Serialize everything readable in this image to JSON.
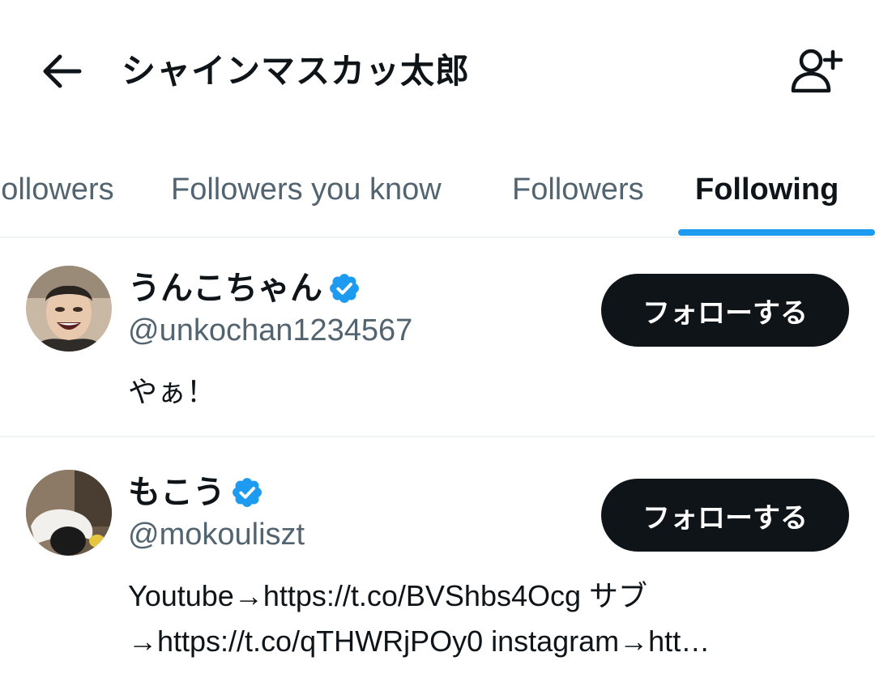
{
  "header": {
    "title": "シャインマスカッ太郎",
    "back_icon": "arrow-left-icon",
    "add_icon": "add-person-icon"
  },
  "tabs": [
    {
      "label": "Followers",
      "active": false
    },
    {
      "label": "Followers you know",
      "active": false
    },
    {
      "label": "Followers",
      "active": false
    },
    {
      "label": "Following",
      "active": true
    }
  ],
  "colors": {
    "accent": "#1d9bf0",
    "text": "#0f1419",
    "secondary": "#536471",
    "button_bg": "#0f1419"
  },
  "users": [
    {
      "name": "うんこちゃん",
      "handle": "@unkochan1234567",
      "verified": true,
      "follow_label": "フォローする",
      "bio": [
        "やぁ！"
      ]
    },
    {
      "name": "もこう",
      "handle": "@mokouliszt",
      "verified": true,
      "follow_label": "フォローする",
      "bio": [
        "Youtube→https://t.co/BVShbs4Ocg サブ",
        "→https://t.co/qTHWRjPOy0 instagram→htt…"
      ]
    }
  ]
}
